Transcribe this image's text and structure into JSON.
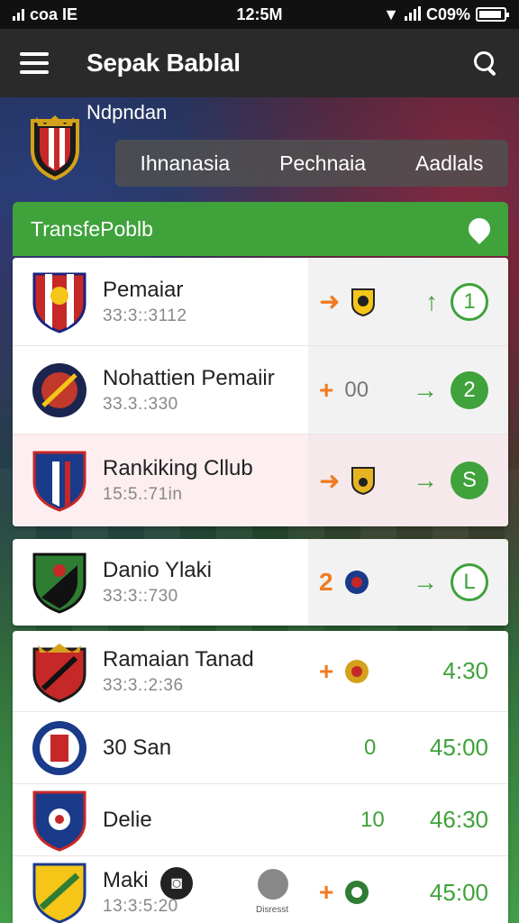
{
  "status_bar": {
    "left_text": "coa IE",
    "time": "12:5M",
    "battery_text": "C09%"
  },
  "app_bar": {
    "title": "Sepak Bablal"
  },
  "header": {
    "league_name": "Ndpndan",
    "tabs": [
      "Ihnanasia",
      "Pechnaia",
      "Aadlals"
    ]
  },
  "section": {
    "title": "TransfePoblb"
  },
  "colors": {
    "accent_green": "#3fa23b",
    "accent_orange": "#f07b22",
    "app_bar": "#2a2a2a"
  },
  "card1": [
    {
      "name": "Pemaiar",
      "sub": "33:3::3112",
      "mid_icon": "plus",
      "right_arrow": "up",
      "right_value": "1",
      "right_style": "outline"
    },
    {
      "name": "Nohattien Pemaiir",
      "sub": "33.3.:330",
      "mid_icon": "plus",
      "mid_text": "00",
      "right_arrow": "right",
      "right_value": "2",
      "right_style": "filled"
    },
    {
      "name": "Rankiking Cllub",
      "sub": "15:5.:71in",
      "mid_icon": "plus",
      "right_arrow": "right",
      "right_value": "S",
      "right_style": "filled"
    }
  ],
  "card2": [
    {
      "name": "Danio Ylaki",
      "sub": "33:3::730",
      "mid_text": "2",
      "right_arrow": "right",
      "right_value": "L",
      "right_style": "outline"
    }
  ],
  "card3": [
    {
      "name": "Ramaian Tanad",
      "sub": "33:3.:2:36",
      "mid_icon": "plus",
      "score": "4:30"
    },
    {
      "name": "30 San",
      "sub": "",
      "mid_text": "0",
      "score": "45:00"
    },
    {
      "name": "Delie",
      "sub": "",
      "mid_text": "10",
      "score": "46:30"
    },
    {
      "name": "Maki",
      "sub": "13:3:5:20",
      "mid_icon": "plus",
      "score": "45:00",
      "overlay_label": "Disresst"
    }
  ]
}
